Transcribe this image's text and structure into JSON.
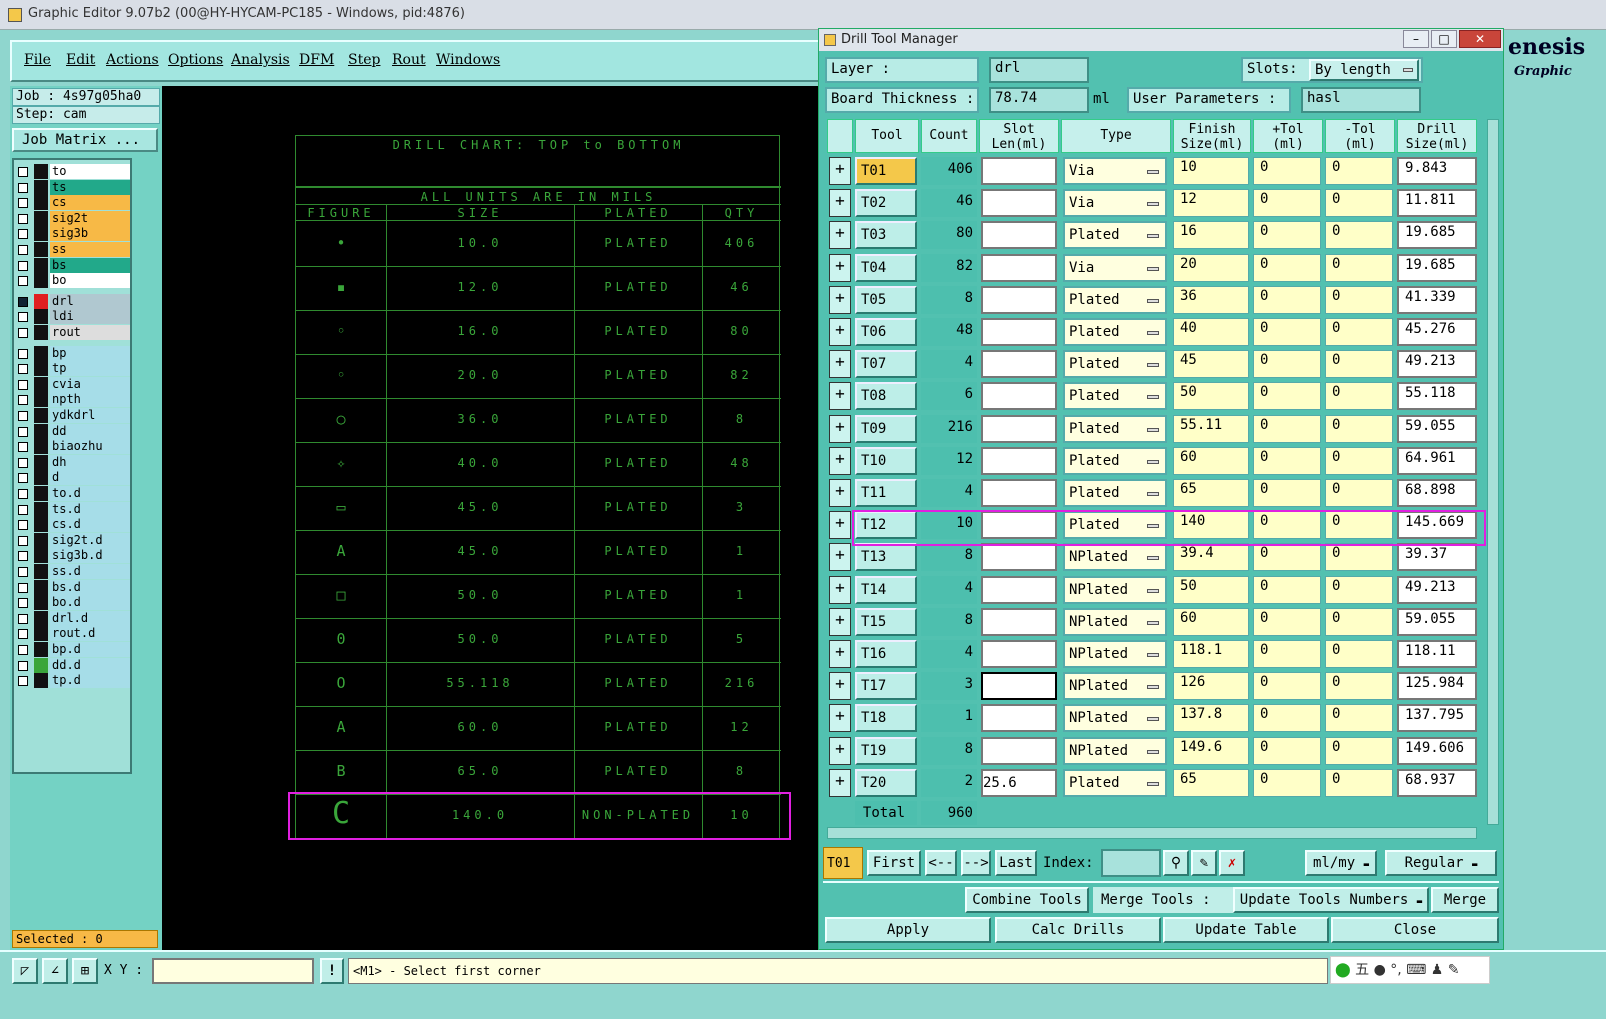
{
  "window_title": "Graphic Editor 9.07b2 (00@HY-HYCAM-PC185 - Windows, pid:4876)",
  "menu": [
    "File",
    "Edit",
    "Actions",
    "Options",
    "Analysis",
    "DFM",
    "Step",
    "Rout",
    "Windows"
  ],
  "job": {
    "job_label": "Job : 4s97g05ha0",
    "step_label": "Step: cam",
    "matrix_button": "Job Matrix ..."
  },
  "layers": [
    {
      "name": "to",
      "color": "#ffffff"
    },
    {
      "name": "ts",
      "color": "#22a98a"
    },
    {
      "name": "cs",
      "color": "#f7b946"
    },
    {
      "name": "sig2t",
      "color": "#f7b946"
    },
    {
      "name": "sig3b",
      "color": "#f7b946"
    },
    {
      "name": "ss",
      "color": "#f7b946"
    },
    {
      "name": "bs",
      "color": "#22a98a"
    },
    {
      "name": "bo",
      "color": "#ffffff"
    },
    {
      "name": "drl",
      "color": "#b0c8d0"
    },
    {
      "name": "ldi",
      "color": "#b0c8d0"
    },
    {
      "name": "rout",
      "color": "#dddddd"
    },
    {
      "name": "bp",
      "color": "#a6dde8"
    },
    {
      "name": "tp",
      "color": "#a6dde8"
    },
    {
      "name": "cvia",
      "color": "#a6dde8"
    },
    {
      "name": "npth",
      "color": "#a6dde8"
    },
    {
      "name": "ydkdrl",
      "color": "#a6dde8"
    },
    {
      "name": "dd",
      "color": "#a6dde8"
    },
    {
      "name": "biaozhu",
      "color": "#a6dde8"
    },
    {
      "name": "dh",
      "color": "#a6dde8"
    },
    {
      "name": "d",
      "color": "#a6dde8"
    },
    {
      "name": "to.d",
      "color": "#a6dde8"
    },
    {
      "name": "ts.d",
      "color": "#a6dde8"
    },
    {
      "name": "cs.d",
      "color": "#a6dde8"
    },
    {
      "name": "sig2t.d",
      "color": "#a6dde8"
    },
    {
      "name": "sig3b.d",
      "color": "#a6dde8"
    },
    {
      "name": "ss.d",
      "color": "#a6dde8"
    },
    {
      "name": "bs.d",
      "color": "#a6dde8"
    },
    {
      "name": "bo.d",
      "color": "#a6dde8"
    },
    {
      "name": "drl.d",
      "color": "#a6dde8"
    },
    {
      "name": "rout.d",
      "color": "#a6dde8"
    },
    {
      "name": "bp.d",
      "color": "#a6dde8"
    },
    {
      "name": "dd.d",
      "color": "#a6dde8"
    },
    {
      "name": "tp.d",
      "color": "#a6dde8"
    }
  ],
  "selected_status": "Selected : 0",
  "drill_chart": {
    "title": "DRILL CHART: TOP to BOTTOM",
    "units": "ALL UNITS ARE IN MILS",
    "headers": [
      "FIGURE",
      "SIZE",
      "PLATED",
      "QTY"
    ],
    "rows": [
      {
        "fig": "•",
        "size": "10.0",
        "plated": "PLATED",
        "qty": "406"
      },
      {
        "fig": "▪",
        "size": "12.0",
        "plated": "PLATED",
        "qty": "46"
      },
      {
        "fig": "◦",
        "size": "16.0",
        "plated": "PLATED",
        "qty": "80"
      },
      {
        "fig": "◦",
        "size": "20.0",
        "plated": "PLATED",
        "qty": "82"
      },
      {
        "fig": "○",
        "size": "36.0",
        "plated": "PLATED",
        "qty": "8"
      },
      {
        "fig": "✧",
        "size": "40.0",
        "plated": "PLATED",
        "qty": "48"
      },
      {
        "fig": "▭",
        "size": "45.0",
        "plated": "PLATED",
        "qty": "3"
      },
      {
        "fig": "A",
        "size": "45.0",
        "plated": "PLATED",
        "qty": "1"
      },
      {
        "fig": "□",
        "size": "50.0",
        "plated": "PLATED",
        "qty": "1"
      },
      {
        "fig": "0",
        "size": "50.0",
        "plated": "PLATED",
        "qty": "5"
      },
      {
        "fig": "O",
        "size": "55.118",
        "plated": "PLATED",
        "qty": "216"
      },
      {
        "fig": "A",
        "size": "60.0",
        "plated": "PLATED",
        "qty": "12"
      },
      {
        "fig": "B",
        "size": "65.0",
        "plated": "PLATED",
        "qty": "8"
      },
      {
        "fig": "C",
        "size": "140.0",
        "plated": "NON-PLATED",
        "qty": "10"
      }
    ]
  },
  "dtm": {
    "title": "Drill Tool Manager",
    "layer_label": "Layer          :",
    "layer_value": "drl",
    "slots_label": "Slots:",
    "slots_value": "By length",
    "thickness_label": "Board Thickness :",
    "thickness_value": "78.74",
    "thickness_unit": "ml",
    "user_params_label": "User Parameters :",
    "user_params_value": "hasl",
    "headers": [
      "Tool",
      "Count",
      "Slot\nLen(ml)",
      "Type",
      "Finish\nSize(ml)",
      "+Tol\n(ml)",
      "-Tol\n(ml)",
      "Drill\nSize(ml)"
    ],
    "rows": [
      {
        "tool": "T01",
        "count": "406",
        "slot": "",
        "type": "Via",
        "finish": "10",
        "ptol": "0",
        "mtol": "0",
        "drill": "9.843"
      },
      {
        "tool": "T02",
        "count": "46",
        "slot": "",
        "type": "Via",
        "finish": "12",
        "ptol": "0",
        "mtol": "0",
        "drill": "11.811"
      },
      {
        "tool": "T03",
        "count": "80",
        "slot": "",
        "type": "Plated",
        "finish": "16",
        "ptol": "0",
        "mtol": "0",
        "drill": "19.685"
      },
      {
        "tool": "T04",
        "count": "82",
        "slot": "",
        "type": "Via",
        "finish": "20",
        "ptol": "0",
        "mtol": "0",
        "drill": "19.685"
      },
      {
        "tool": "T05",
        "count": "8",
        "slot": "",
        "type": "Plated",
        "finish": "36",
        "ptol": "0",
        "mtol": "0",
        "drill": "41.339"
      },
      {
        "tool": "T06",
        "count": "48",
        "slot": "",
        "type": "Plated",
        "finish": "40",
        "ptol": "0",
        "mtol": "0",
        "drill": "45.276"
      },
      {
        "tool": "T07",
        "count": "4",
        "slot": "",
        "type": "Plated",
        "finish": "45",
        "ptol": "0",
        "mtol": "0",
        "drill": "49.213"
      },
      {
        "tool": "T08",
        "count": "6",
        "slot": "",
        "type": "Plated",
        "finish": "50",
        "ptol": "0",
        "mtol": "0",
        "drill": "55.118"
      },
      {
        "tool": "T09",
        "count": "216",
        "slot": "",
        "type": "Plated",
        "finish": "55.11",
        "ptol": "0",
        "mtol": "0",
        "drill": "59.055"
      },
      {
        "tool": "T10",
        "count": "12",
        "slot": "",
        "type": "Plated",
        "finish": "60",
        "ptol": "0",
        "mtol": "0",
        "drill": "64.961"
      },
      {
        "tool": "T11",
        "count": "4",
        "slot": "",
        "type": "Plated",
        "finish": "65",
        "ptol": "0",
        "mtol": "0",
        "drill": "68.898"
      },
      {
        "tool": "T12",
        "count": "10",
        "slot": "",
        "type": "Plated",
        "finish": "140",
        "ptol": "0",
        "mtol": "0",
        "drill": "145.669"
      },
      {
        "tool": "T13",
        "count": "8",
        "slot": "",
        "type": "NPlated",
        "finish": "39.4",
        "ptol": "0",
        "mtol": "0",
        "drill": "39.37"
      },
      {
        "tool": "T14",
        "count": "4",
        "slot": "",
        "type": "NPlated",
        "finish": "50",
        "ptol": "0",
        "mtol": "0",
        "drill": "49.213"
      },
      {
        "tool": "T15",
        "count": "8",
        "slot": "",
        "type": "NPlated",
        "finish": "60",
        "ptol": "0",
        "mtol": "0",
        "drill": "59.055"
      },
      {
        "tool": "T16",
        "count": "4",
        "slot": "",
        "type": "NPlated",
        "finish": "118.1",
        "ptol": "0",
        "mtol": "0",
        "drill": "118.11"
      },
      {
        "tool": "T17",
        "count": "3",
        "slot": "",
        "type": "NPlated",
        "finish": "126",
        "ptol": "0",
        "mtol": "0",
        "drill": "125.984"
      },
      {
        "tool": "T18",
        "count": "1",
        "slot": "",
        "type": "NPlated",
        "finish": "137.8",
        "ptol": "0",
        "mtol": "0",
        "drill": "137.795"
      },
      {
        "tool": "T19",
        "count": "8",
        "slot": "",
        "type": "NPlated",
        "finish": "149.6",
        "ptol": "0",
        "mtol": "0",
        "drill": "149.606"
      },
      {
        "tool": "T20",
        "count": "2",
        "slot": "25.6",
        "type": "Plated",
        "finish": "65",
        "ptol": "0",
        "mtol": "0",
        "drill": "68.937"
      }
    ],
    "total_label": "Total",
    "total_value": "960",
    "nav": {
      "current": "T01",
      "first": "First",
      "prev": "<--",
      "next": "-->",
      "last": "Last",
      "index_label": "Index:",
      "units": "ml/my",
      "mode": "Regular"
    },
    "actions": {
      "combine": "Combine Tools",
      "merge_label": "Merge Tools :",
      "update_numbers": "Update Tools Numbers",
      "merge": "Merge"
    },
    "footer": {
      "apply": "Apply",
      "calc": "Calc Drills",
      "update": "Update Table",
      "close": "Close"
    }
  },
  "status": {
    "xy_label": "X Y :",
    "prompt": "<M1> - Select first corner"
  },
  "background_brand": {
    "text": "enesis",
    "sub": "Graphic"
  }
}
